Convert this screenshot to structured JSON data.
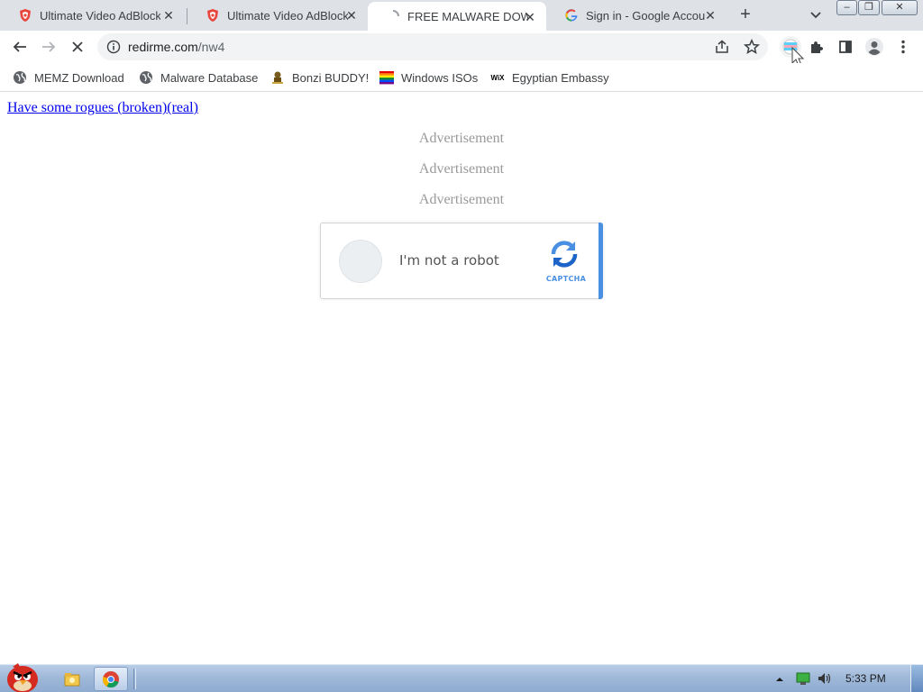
{
  "browser": {
    "tabs": [
      {
        "title": "Ultimate Video AdBlock",
        "icon": "shield-icon",
        "active": false
      },
      {
        "title": "Ultimate Video AdBlock",
        "icon": "shield-icon",
        "active": false
      },
      {
        "title": "FREE MALWARE DOWNL",
        "icon": "loading-icon",
        "active": true
      },
      {
        "title": "Sign in - Google Accou",
        "icon": "google-icon",
        "active": false
      }
    ],
    "new_tab_label": "+",
    "close_glyph": "✕",
    "window_controls": {
      "minimize": "–",
      "restore": "❐",
      "close": "✕"
    },
    "address": {
      "domain": "redirme.com",
      "path": "/nw4"
    },
    "accent_color": "#1a73e8"
  },
  "bookmarks": [
    {
      "label": "MEMZ Download",
      "icon": "globe-icon"
    },
    {
      "label": "Malware Database",
      "icon": "globe-icon"
    },
    {
      "label": "Bonzi BUDDY!",
      "icon": "bonzi-icon"
    },
    {
      "label": "Windows ISOs",
      "icon": "rainbow-flag-icon"
    },
    {
      "label": "Egyptian Embassy",
      "icon": "wix-icon",
      "icon_text": "WiX"
    }
  ],
  "page": {
    "link": "Have some rogues (broken)(real)",
    "ads": [
      "Advertisement",
      "Advertisement",
      "Advertisement"
    ],
    "captcha": {
      "label": "I'm not a robot",
      "brand": "CAPTCHA",
      "accent": "#4a90e2"
    }
  },
  "taskbar": {
    "clock": "5:33 PM",
    "items": [
      "angry-bird-icon",
      "explorer-icon",
      "chrome-icon"
    ]
  }
}
